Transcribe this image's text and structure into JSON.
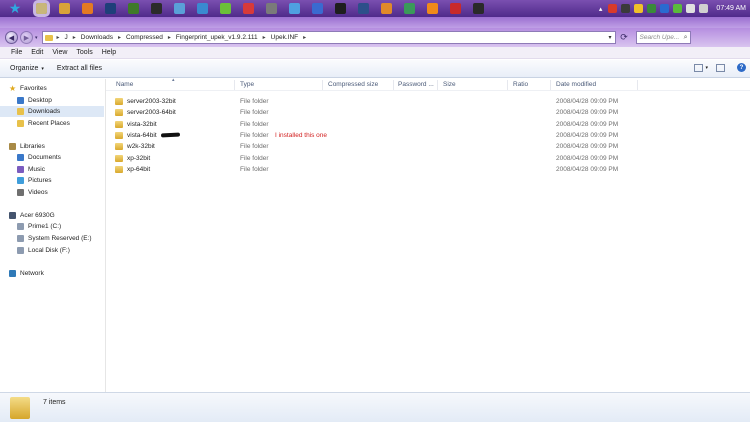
{
  "taskbar": {
    "start_glyph": "★",
    "icons": [
      {
        "name": "explorer-icon",
        "color": "#c8b67a"
      },
      {
        "name": "chrome-icon",
        "color": "#d8a23a"
      },
      {
        "name": "firefox-icon",
        "color": "#e37a22"
      },
      {
        "name": "photoshop-icon",
        "color": "#1f3f7a"
      },
      {
        "name": "app-green-icon",
        "color": "#3f7a2a"
      },
      {
        "name": "app-dark-icon",
        "color": "#2b2b2b"
      },
      {
        "name": "app-doc-icon",
        "color": "#5aa0d8"
      },
      {
        "name": "app-blue-icon",
        "color": "#3a8ad0"
      },
      {
        "name": "app-leaf-icon",
        "color": "#6bbf3a"
      },
      {
        "name": "app-red-icon",
        "color": "#d83a3a"
      },
      {
        "name": "app-grid-icon",
        "color": "#7a7a7a"
      },
      {
        "name": "app-globe-icon",
        "color": "#4fa0e0"
      },
      {
        "name": "app-orb-icon",
        "color": "#3a6ad0"
      },
      {
        "name": "app-eye-icon",
        "color": "#1e1e1e"
      },
      {
        "name": "app-ps-icon",
        "color": "#2d4f8a"
      },
      {
        "name": "app-orange-icon",
        "color": "#e08a2a"
      },
      {
        "name": "app-chat-icon",
        "color": "#3a9a5a"
      },
      {
        "name": "app-vlc-icon",
        "color": "#f08a1a"
      },
      {
        "name": "app-red2-icon",
        "color": "#c82a2a"
      },
      {
        "name": "app-scope-icon",
        "color": "#2a2a2a"
      }
    ],
    "tray_icons": [
      {
        "name": "tray-icon-1",
        "color": "#d83a2a"
      },
      {
        "name": "tray-icon-2",
        "color": "#3a3a3a"
      },
      {
        "name": "tray-icon-3",
        "color": "#f0c02a"
      },
      {
        "name": "tray-icon-4",
        "color": "#3a8a3a"
      },
      {
        "name": "tray-icon-5",
        "color": "#2a6ad0"
      },
      {
        "name": "tray-icon-6",
        "color": "#5aba3a"
      },
      {
        "name": "tray-icon-7",
        "color": "#e0e0e0"
      },
      {
        "name": "tray-icon-8",
        "color": "#d0d0d0"
      }
    ],
    "clock": "07:49 AM"
  },
  "address": {
    "crumbs": [
      "J",
      "Downloads",
      "Compressed",
      "Fingerprint_upek_v1.9.2.111",
      "Upek.INF"
    ],
    "search_placeholder": "Search Upe..."
  },
  "menu": [
    "File",
    "Edit",
    "View",
    "Tools",
    "Help"
  ],
  "command_bar": {
    "organize": "Organize",
    "extract_all": "Extract all files"
  },
  "nav_pane": {
    "favorites": "Favorites",
    "favorites_items": [
      "Desktop",
      "Downloads",
      "Recent Places"
    ],
    "libraries": "Libraries",
    "libraries_items": [
      "Documents",
      "Music",
      "Pictures",
      "Videos"
    ],
    "computer": "Acer 6930G",
    "drives": [
      "Prime1 (C:)",
      "System Reserved (E:)",
      "Local Disk (F:)"
    ],
    "network": "Network"
  },
  "columns": {
    "name": "Name",
    "type": "Type",
    "compressed_size": "Compressed size",
    "password": "Password ...",
    "size": "Size",
    "ratio": "Ratio",
    "date_modified": "Date modified"
  },
  "files": [
    {
      "name": "server2003-32bit",
      "type": "File folder",
      "date": "2008/04/28 09:09 PM"
    },
    {
      "name": "server2003-64bit",
      "type": "File folder",
      "date": "2008/04/28 09:09 PM"
    },
    {
      "name": "vista-32bit",
      "type": "File folder",
      "date": "2008/04/28 09:09 PM"
    },
    {
      "name": "vista-64bit",
      "type": "File folder",
      "date": "2008/04/28 09:09 PM"
    },
    {
      "name": "w2k-32bit",
      "type": "File folder",
      "date": "2008/04/28 09:09 PM"
    },
    {
      "name": "xp-32bit",
      "type": "File folder",
      "date": "2008/04/28 09:09 PM"
    },
    {
      "name": "xp-64bit",
      "type": "File folder",
      "date": "2008/04/28 09:09 PM"
    }
  ],
  "annotation": "I installed this one",
  "details": {
    "items_count": "7 items"
  }
}
